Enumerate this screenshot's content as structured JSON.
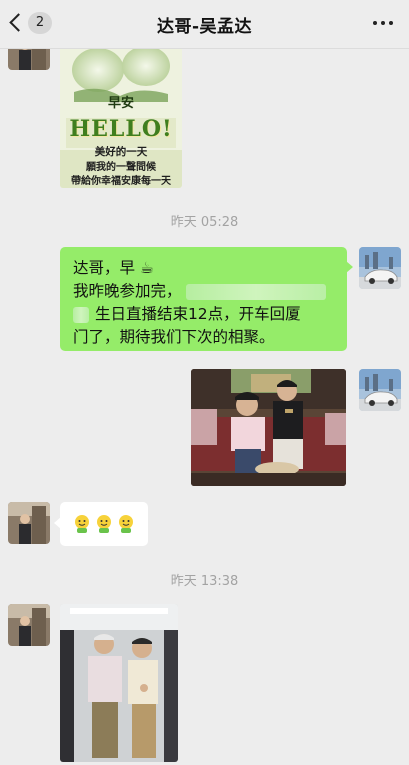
{
  "header": {
    "title": "达哥-吴孟达",
    "back_badge": "2"
  },
  "messages": [
    {
      "kind": "image",
      "sender": "contact",
      "caption": {
        "line1": "早安",
        "hello": "HELLO!",
        "line2": "美好的一天",
        "line3": "願我的一聲問候",
        "line4": "帶給你幸福安康每一天"
      }
    },
    {
      "kind": "timestamp",
      "text": "昨天 05:28"
    },
    {
      "kind": "text",
      "sender": "self",
      "line1": "达哥，早",
      "line1_emoji": "☕",
      "line2": "我昨晚参加完，",
      "line3": "生日直播结束12点，开车回厦",
      "line4": "门了，期待我们下次的相聚。"
    },
    {
      "kind": "image",
      "sender": "self",
      "description_visible": false
    },
    {
      "kind": "emoji",
      "sender": "contact",
      "count": 3
    },
    {
      "kind": "timestamp",
      "text": "昨天 13:38"
    },
    {
      "kind": "image",
      "sender": "contact",
      "description_visible": false
    }
  ],
  "colors": {
    "background": "#ededed",
    "self_bubble": "#95ec69",
    "contact_bubble": "#ffffff",
    "timestamp": "#a3a3a3"
  },
  "icons": {
    "back": "chevron-left-icon",
    "more": "more-dots-icon"
  }
}
